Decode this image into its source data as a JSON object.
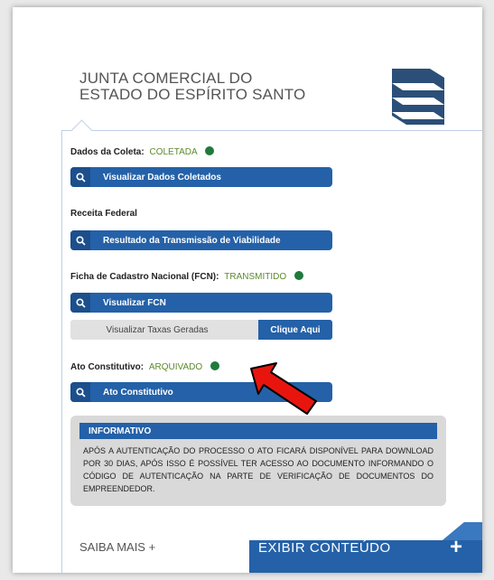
{
  "header": {
    "title_line1": "JUNTA COMERCIAL DO",
    "title_line2": "ESTADO DO ESPÍRITO SANTO"
  },
  "sections": {
    "coleta": {
      "label": "Dados da Coleta:",
      "status": "COLETADA",
      "button": "Visualizar Dados Coletados"
    },
    "receita": {
      "label": "Receita Federal",
      "button": "Resultado da Transmissão de Viabilidade"
    },
    "fcn": {
      "label": "Ficha de Cadastro Nacional (FCN):",
      "status": "TRANSMITIDO",
      "button": "Visualizar FCN"
    },
    "taxas": {
      "text": "Visualizar Taxas Geradas",
      "button": "Clique Aqui"
    },
    "ato": {
      "label": "Ato Constitutivo:",
      "status": "ARQUIVADO",
      "button": "Ato Constitutivo"
    }
  },
  "informativo": {
    "title": "INFORMATIVO",
    "text": "APÓS A AUTENTICAÇÃO DO PROCESSO O ATO FICARÁ DISPONÍVEL PARA DOWNLOAD POR 30 DIAS, APÓS ISSO É POSSÍVEL TER ACESSO AO DOCUMENTO INFORMANDO O CÓDIGO DE AUTENTICAÇÃO NA PARTE DE VERIFICAÇÃO DE DOCUMENTOS DO EMPREENDEDOR."
  },
  "footer": {
    "saiba_mais": "SAIBA MAIS +",
    "exibir": "EXIBIR CONTEÚDO",
    "plus": "+"
  },
  "icons": {
    "search": "search-icon",
    "status_dot": "status-dot-icon",
    "annotation_arrow": "red-arrow-icon",
    "logo": "junta-logo-icon"
  },
  "colors": {
    "primary_blue": "#2461a8",
    "status_green": "#1f7a3d",
    "status_text": "#5c8a2c",
    "arrow_red": "#e8150f"
  }
}
